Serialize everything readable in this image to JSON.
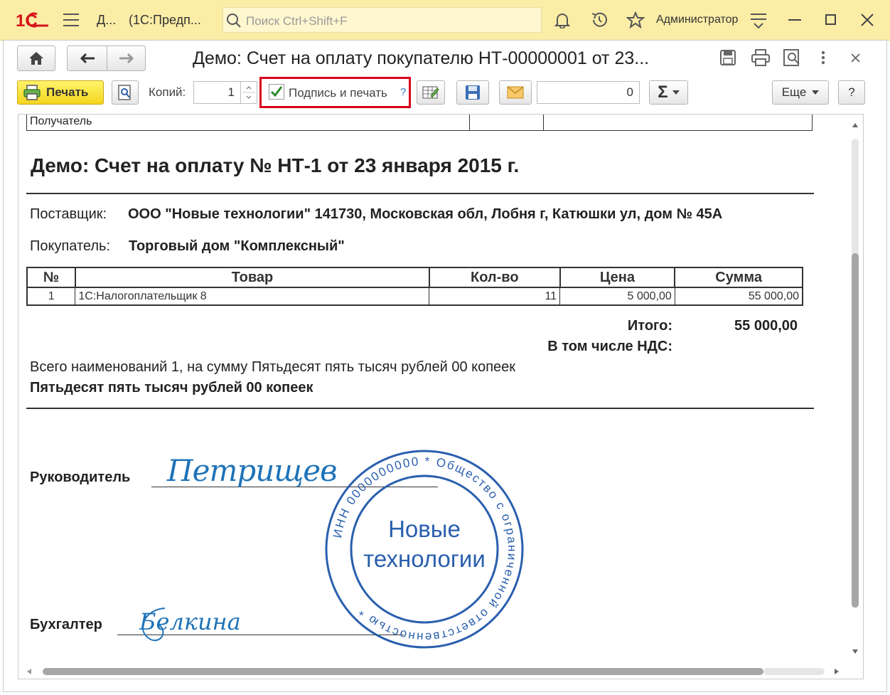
{
  "titlebar": {
    "logo": "1С",
    "tab_title": "Д...",
    "app_title": "(1С:Предп...",
    "search_placeholder": "Поиск Ctrl+Shift+F",
    "user": "Администратор"
  },
  "window": {
    "title": "Демо: Счет на оплату покупателю НТ-00000001 от 23...",
    "print_label": "Печать",
    "copies_label": "Копий:",
    "copies_value": "1",
    "sign_print_label": "Подпись и печать",
    "help_mark": "?",
    "sum_value": "0",
    "sum_symbol": "Σ",
    "more_label": "Еще",
    "help_label": "?"
  },
  "document": {
    "recipient_label": "Получатель",
    "heading": "Демо: Счет на оплату № НТ-1 от 23 января 2015 г.",
    "supplier_label": "Поставщик:",
    "supplier_value": "ООО \"Новые технологии\" 141730, Московская обл, Лобня г, Катюшки ул, дом № 45А",
    "buyer_label": "Покупатель:",
    "buyer_value": "Торговый дом \"Комплексный\"",
    "table_headers": [
      "№",
      "Товар",
      "Кол-во",
      "Цена",
      "Сумма"
    ],
    "table_rows": [
      [
        "1",
        "1С:Налогоплательщик 8",
        "11",
        "5 000,00",
        "55 000,00"
      ]
    ],
    "total_label": "Итого:",
    "total_value": "55 000,00",
    "vat_label": "В том числе НДС:",
    "summary_line": "Всего наименований 1, на сумму Пятьдесят пять тысяч рублей 00 копеек",
    "amount_words": "Пятьдесят пять тысяч рублей 00 копеек",
    "head_label": "Руководитель",
    "head_signature": "Петрищев",
    "accountant_label": "Бухгалтер",
    "accountant_signature": "Белкина",
    "stamp_center_line1": "Новые",
    "stamp_center_line2": "технологии",
    "stamp_ring_text": "ИНН 0000000000 * Общество с ограниченной ответственностью *"
  },
  "colors": {
    "titlebar_bg": "#fbeda6",
    "print_button": "#f5d51e",
    "highlight_border": "#d9001b",
    "stamp_blue": "#2a5fae",
    "signature_blue": "#1e73b8"
  }
}
